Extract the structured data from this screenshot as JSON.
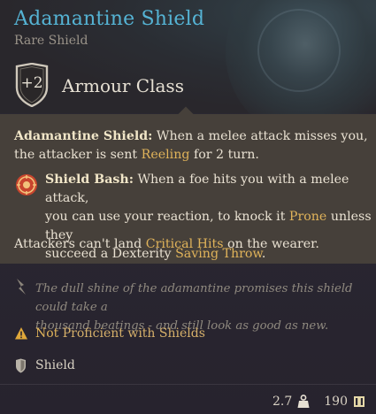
{
  "item": {
    "name": "Adamantine Shield",
    "rarity_type": "Rare Shield",
    "armour_class_bonus": "+2",
    "armour_class_label": "Armour Class"
  },
  "description": {
    "p1_keyword": "Adamantine Shield:",
    "p1_text_a": " When a melee attack misses you,",
    "p1_text_b": "the attacker is sent ",
    "p1_reeling": "Reeling",
    "p1_text_c": " for 2 turn.",
    "p2_keyword": "Shield Bash:",
    "p2_text_a": " When a foe hits you with a melee attack,",
    "p2_text_b": "you can use your reaction, to knock it ",
    "p2_prone": "Prone",
    "p2_text_c": " unless they",
    "p2_text_d": "succeed a Dexterity ",
    "p2_saving": "Saving Throw",
    "p2_text_e": ".",
    "p3_text_a": "Attackers can't land ",
    "p3_crit": "Critical Hits",
    "p3_text_b": " on the wearer."
  },
  "lore": {
    "line1": "The dull shine of the adamantine promises this shield could take a",
    "line2": "thousand beatings - and still look as good as new."
  },
  "proficiency": {
    "not": "Not",
    "proficient": " Proficient",
    "with": " with Shields"
  },
  "category": "Shield",
  "footer": {
    "weight": "2.7",
    "value": "190"
  },
  "colors": {
    "title": "#55b3d4",
    "gold": "#e0b35a",
    "panel": "#46403a"
  }
}
